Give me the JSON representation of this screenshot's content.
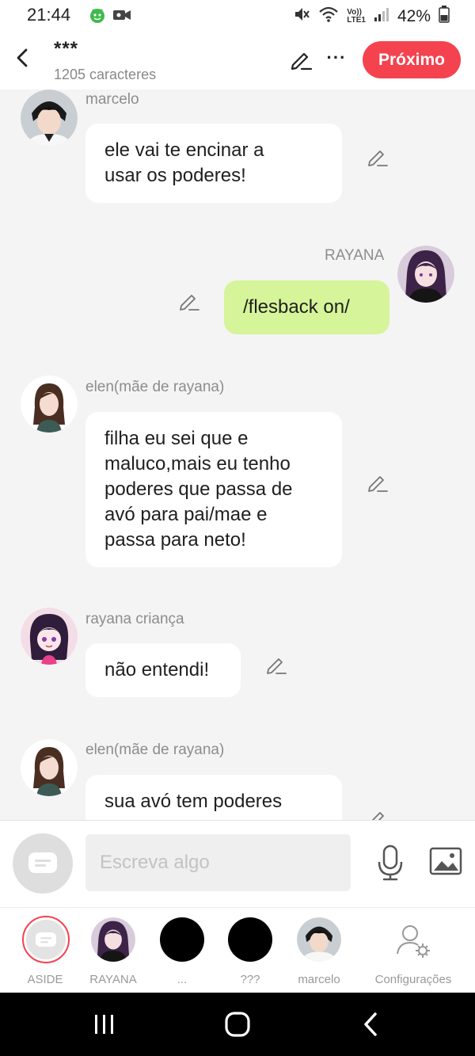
{
  "status_bar": {
    "time": "21:44",
    "battery": "42%",
    "left_icons": [
      "android-face-icon",
      "video-camera-icon"
    ],
    "right_icons": [
      "muted-icon",
      "wifi-icon",
      "volte-icon",
      "signal-icon",
      "battery-icon"
    ],
    "volte_label_1": "Vo))",
    "volte_label_2": "LTE1"
  },
  "header": {
    "title": "***",
    "subtitle": "1205 caracteres",
    "next_label": "Próximo",
    "more_label": "···",
    "accent_color": "#f5424f"
  },
  "messages": [
    {
      "sender": "marcelo",
      "text": "ele vai te encinar a\nusar os poderes!",
      "side": "left"
    },
    {
      "sender": "RAYANA",
      "text": "/flesback on/",
      "side": "right"
    },
    {
      "sender": "elen(mãe de rayana)",
      "text": "filha eu sei que e\nmaluco,mais eu tenho\npoderes que passa de\navó para pai/mae e\npassa para neto!",
      "side": "left"
    },
    {
      "sender": "rayana criança",
      "text": "não entendi!",
      "side": "left"
    },
    {
      "sender": "elen(mãe de rayana)",
      "text": "sua avó tem poderes",
      "side": "left"
    }
  ],
  "composer": {
    "placeholder": "Escreva algo"
  },
  "tabs": [
    {
      "label": "ASIDE"
    },
    {
      "label": "RAYANA"
    },
    {
      "label": "..."
    },
    {
      "label": "???"
    },
    {
      "label": "marcelo"
    },
    {
      "label": "Configurações"
    }
  ],
  "colors": {
    "my_bubble": "#d6f499",
    "other_bubble": "#ffffff",
    "background": "#f4f4f4"
  }
}
